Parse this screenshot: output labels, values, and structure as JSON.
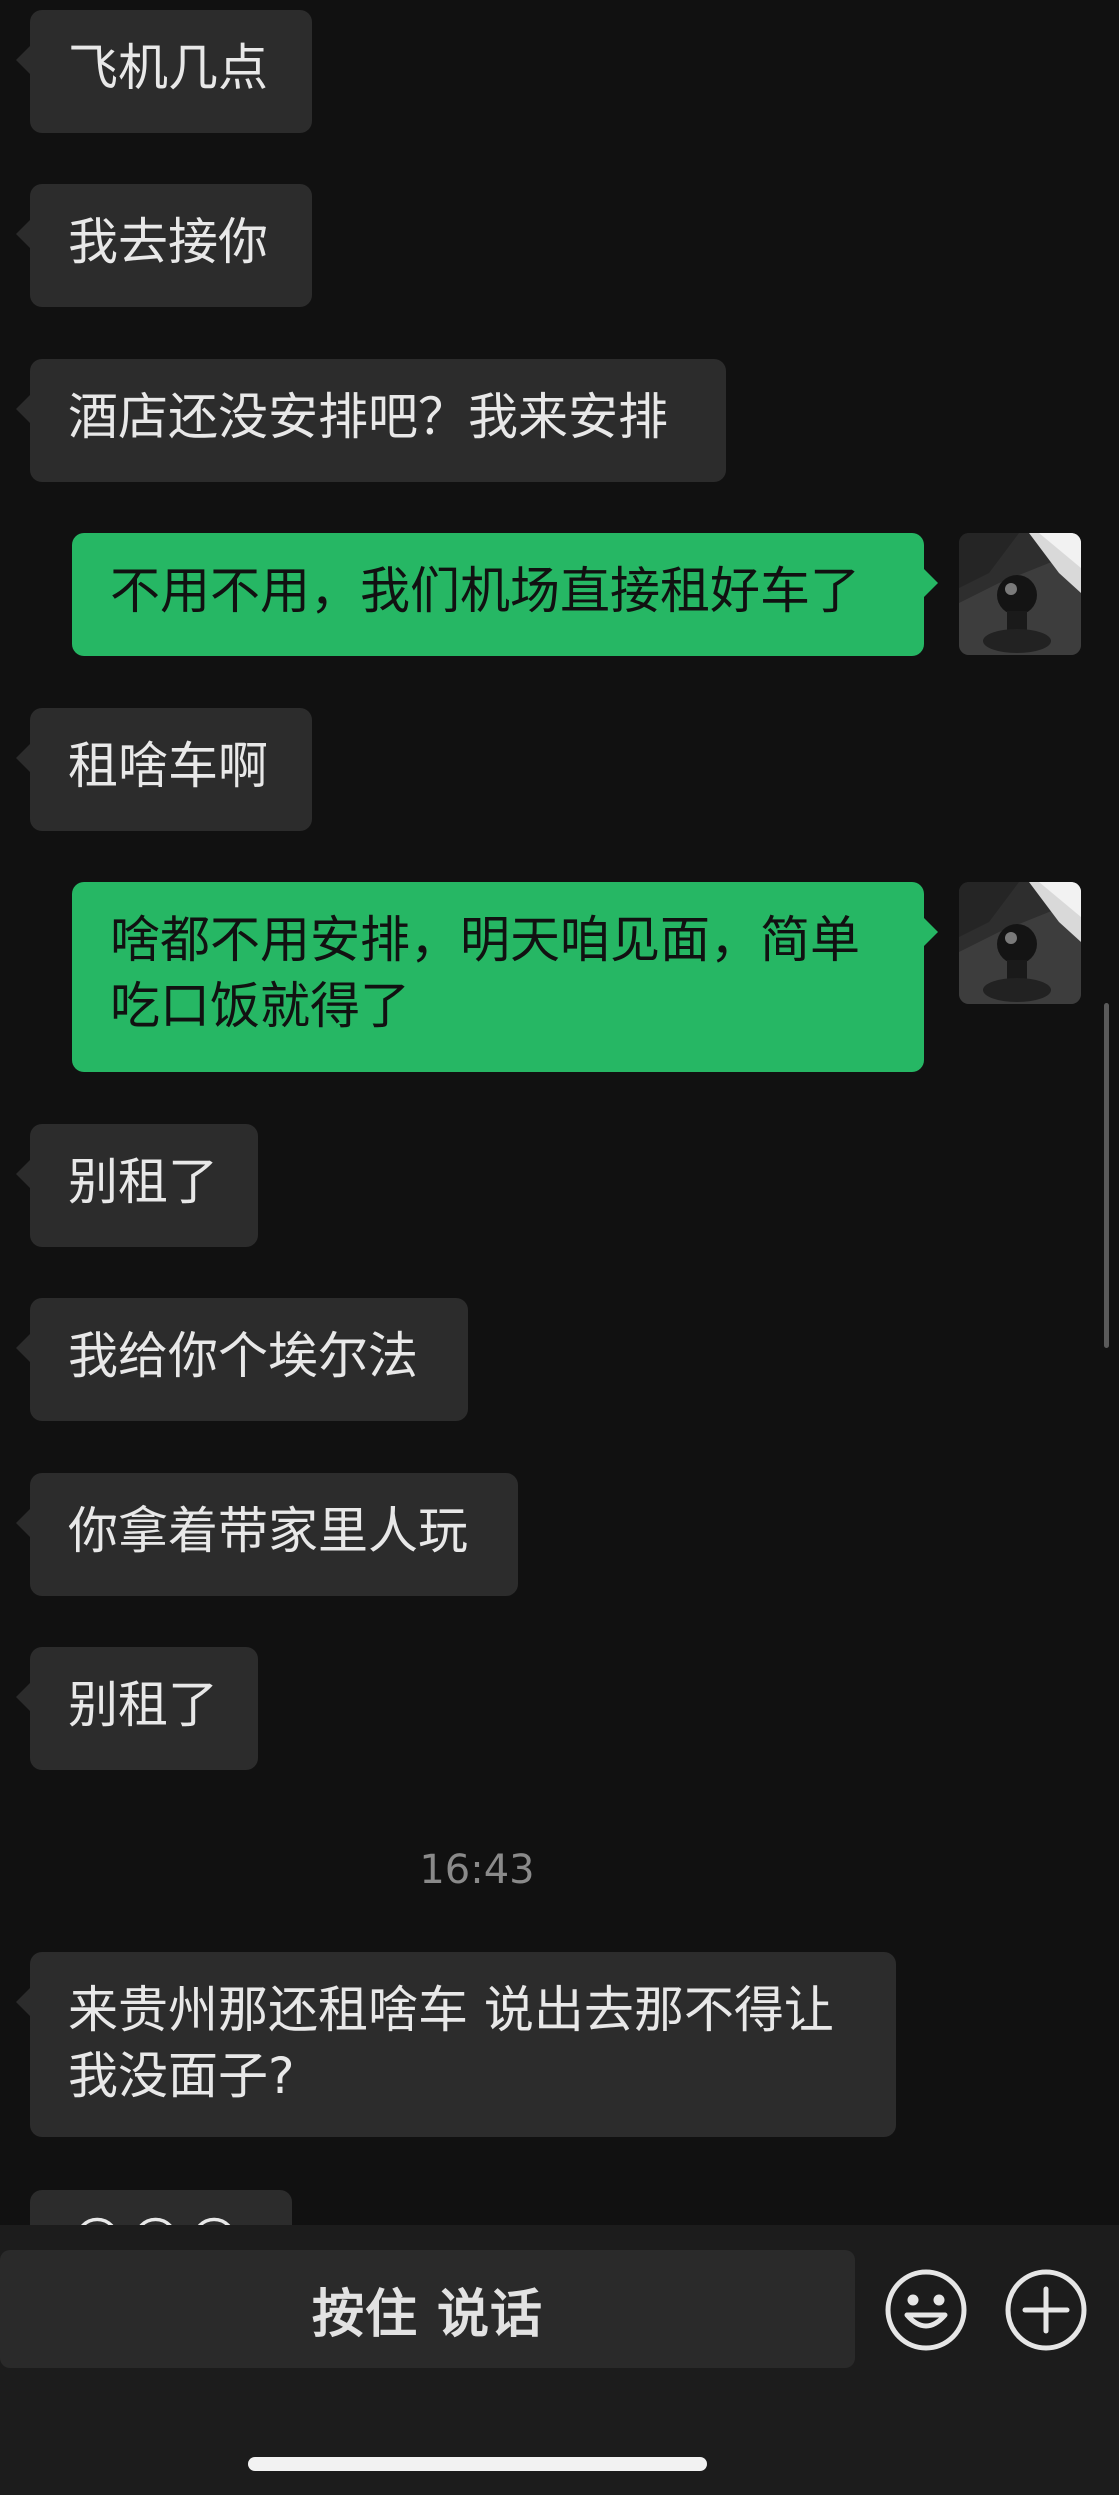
{
  "messages": [
    {
      "side": "in",
      "text": "飞机几点"
    },
    {
      "side": "in",
      "text": "我去接你"
    },
    {
      "side": "in",
      "text": "酒店还没安排吧？我来安排"
    },
    {
      "side": "out",
      "text": "不用不用，我们机场直接租好车了"
    },
    {
      "side": "in",
      "text": "租啥车啊"
    },
    {
      "side": "out",
      "text": "啥都不用安排，明天咱见面，简单\n吃口饭就得了"
    },
    {
      "side": "in",
      "text": "别租了"
    },
    {
      "side": "in",
      "text": "我给你个埃尔法"
    },
    {
      "side": "in",
      "text": "你拿着带家里人玩"
    },
    {
      "side": "in",
      "text": "别租了"
    },
    {
      "side": "in",
      "text": "来贵州那还租啥车 说出去那不得让\n我没面子?"
    },
    {
      "side": "in",
      "text": "😂😂😂"
    }
  ],
  "timestamp": "16:43",
  "input_bar": {
    "voice_label": "按住 说话",
    "emoji_icon": "emoji-icon",
    "plus_icon": "plus-icon"
  },
  "colors": {
    "background": "#111111",
    "incoming_bubble": "#2c2c2c",
    "outgoing_bubble": "#26b764"
  }
}
